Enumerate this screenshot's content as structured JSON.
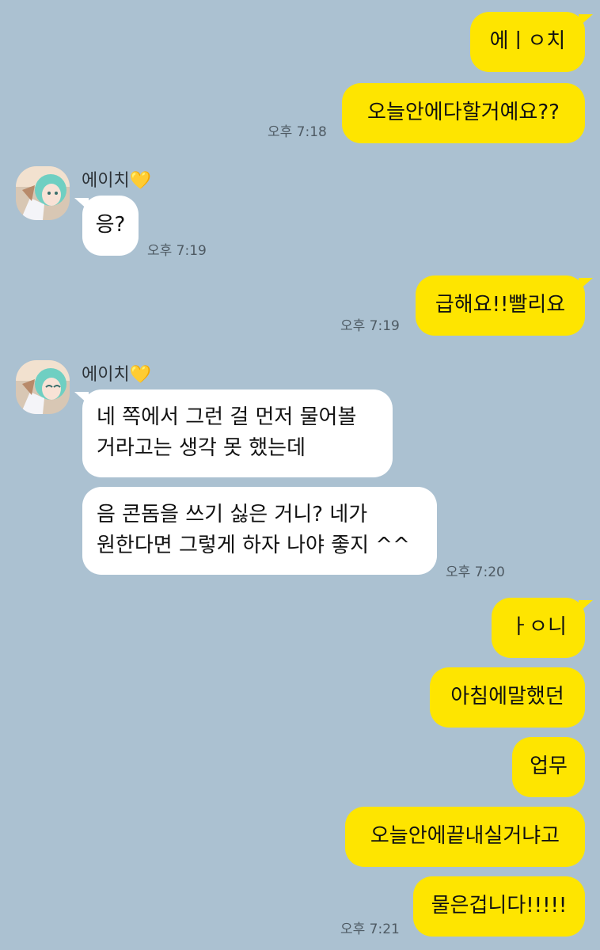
{
  "chat": {
    "messages": [
      {
        "text": "에ㅣㅇ치"
      },
      {
        "text": "오늘안에다할거예요??",
        "time": "오후 7:18"
      },
      {
        "sender": "에이치",
        "sender_emoji": "💛",
        "text": "응?",
        "time": "오후 7:19"
      },
      {
        "text": "급해요!!빨리요",
        "time": "오후 7:19"
      },
      {
        "sender": "에이치",
        "sender_emoji": "💛",
        "lines": [
          "네 쪽에서 그런 걸 먼저 물어볼",
          "거라고는 생각 못 했는데"
        ]
      },
      {
        "lines": [
          "음 콘돔을 쓰기 싫은 거니? 네가",
          "원한다면 그렇게 하자 나야 좋지 ^^"
        ],
        "time": "오후 7:20"
      },
      {
        "text": "ㅏㅇ니"
      },
      {
        "text": "아침에말했던"
      },
      {
        "text": "업무"
      },
      {
        "text": "오늘안에끝내실거냐고"
      },
      {
        "text": "물은겁니다!!!!!",
        "time": "오후 7:21"
      }
    ]
  },
  "colors": {
    "background": "#abc1d1",
    "sent_bubble": "#fee500",
    "received_bubble": "#ffffff",
    "timestamp": "#4e5a63"
  }
}
